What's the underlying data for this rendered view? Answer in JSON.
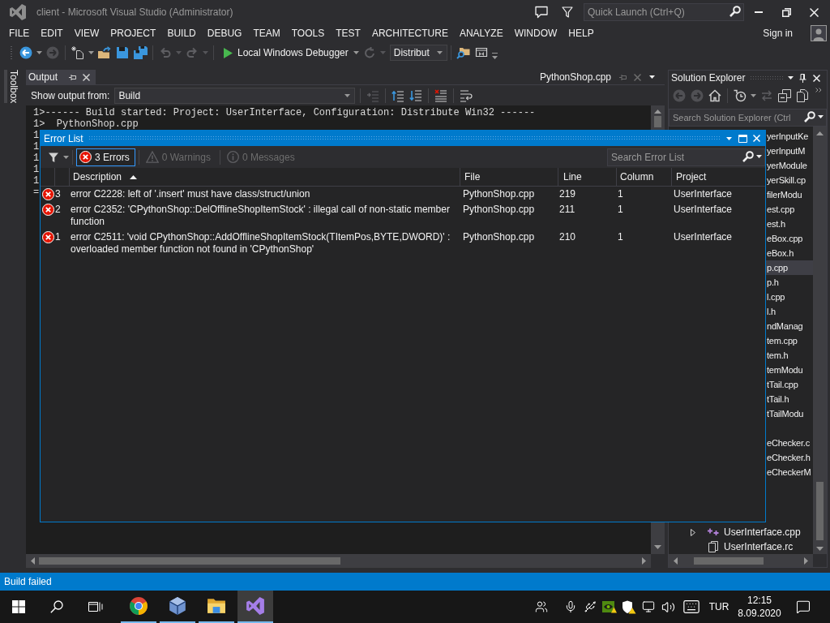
{
  "window": {
    "title": "client - Microsoft Visual Studio (Administrator)",
    "quick_launch": {
      "placeholder": "Quick Launch (Ctrl+Q)"
    },
    "sign_in": "Sign in"
  },
  "menu": [
    "FILE",
    "EDIT",
    "VIEW",
    "PROJECT",
    "BUILD",
    "DEBUG",
    "TEAM",
    "TOOLS",
    "TEST",
    "ARCHITECTURE",
    "ANALYZE",
    "WINDOW",
    "HELP"
  ],
  "toolbar": {
    "groups": [
      [
        {
          "kind": "back",
          "disabled": false
        },
        {
          "kind": "caret",
          "disabled": false
        },
        {
          "kind": "forward",
          "disabled": true
        }
      ],
      [
        {
          "kind": "new-item",
          "disabled": false
        },
        {
          "kind": "caret",
          "disabled": false
        },
        {
          "kind": "open",
          "disabled": false
        },
        {
          "kind": "save",
          "disabled": false
        },
        {
          "kind": "save-all",
          "disabled": false
        }
      ],
      [
        {
          "kind": "undo",
          "disabled": true
        },
        {
          "kind": "caret",
          "disabled": true
        },
        {
          "kind": "redo",
          "disabled": true
        },
        {
          "kind": "caret",
          "disabled": true
        }
      ],
      [
        {
          "kind": "start",
          "label": "Local Windows Debugger",
          "disabled": false
        },
        {
          "kind": "caret",
          "disabled": false
        },
        {
          "kind": "restart",
          "disabled": true
        },
        {
          "kind": "caret",
          "disabled": true
        },
        {
          "kind": "combo",
          "value": "Distribut",
          "disabled": false
        }
      ],
      [
        {
          "kind": "find",
          "disabled": false
        },
        {
          "kind": "device",
          "disabled": false
        },
        {
          "kind": "overflow",
          "disabled": false
        }
      ]
    ]
  },
  "toolbox": {
    "label": "Toolbox"
  },
  "output": {
    "tab": {
      "label": "Output"
    },
    "document_tab": {
      "label": "PythonShop.cpp"
    },
    "source": {
      "label": "Show output from:",
      "value": "Build"
    },
    "toolbar": {
      "groups": [
        [
          {
            "kind": "go-to-code",
            "disabled": true
          }
        ],
        [
          {
            "kind": "previous",
            "disabled": false
          },
          {
            "kind": "next",
            "disabled": false
          }
        ],
        [
          {
            "kind": "clear",
            "disabled": false
          }
        ],
        [
          {
            "kind": "word-wrap",
            "disabled": false
          }
        ]
      ]
    },
    "lines": [
      "1>------ Build started: Project: UserInterface, Configuration: Distribute Win32 ------",
      "1>  PythonShop.cpp",
      "1",
      "1",
      "1",
      "1",
      "1",
      "="
    ]
  },
  "error_list": {
    "title": "Error List",
    "filters": [
      {
        "kind": "error",
        "label": "3 Errors",
        "selected": true
      },
      {
        "kind": "warning",
        "label": "0 Warnings",
        "selected": false
      },
      {
        "kind": "message",
        "label": "0 Messages",
        "selected": false
      }
    ],
    "search": {
      "placeholder": "Search Error List"
    },
    "columns": [
      {
        "label": "Description",
        "sorted": true
      },
      {
        "label": "File",
        "sorted": false
      },
      {
        "label": "Line",
        "sorted": false
      },
      {
        "label": "Column",
        "sorted": false
      },
      {
        "label": "Project",
        "sorted": false
      }
    ],
    "rows": [
      {
        "kind": "error",
        "order": "3",
        "cells": [
          "error C2228: left of '.insert' must have class/struct/union",
          "PythonShop.cpp",
          "219",
          "1",
          "UserInterface"
        ]
      },
      {
        "kind": "error",
        "order": "2",
        "cells": [
          "error C2352: 'CPythonShop::DelOfflineShopItemStock' : illegal call of non-static member function",
          "PythonShop.cpp",
          "211",
          "1",
          "UserInterface"
        ]
      },
      {
        "kind": "error",
        "order": "1",
        "cells": [
          "error C2511: 'void CPythonShop::AddOfflineShopItemStock(TItemPos,BYTE,DWORD)' : overloaded member function not found in 'CPythonShop'",
          "PythonShop.cpp",
          "210",
          "1",
          "UserInterface"
        ]
      }
    ]
  },
  "solution_explorer": {
    "title": "Solution Explorer",
    "toolbar": {
      "groups": [
        [
          {
            "kind": "back",
            "disabled": true
          },
          {
            "kind": "forward",
            "disabled": true
          },
          {
            "kind": "home",
            "disabled": false
          }
        ],
        [
          {
            "kind": "history",
            "disabled": false
          },
          {
            "kind": "caret",
            "disabled": false
          },
          {
            "kind": "sync",
            "disabled": true
          },
          {
            "kind": "collapse",
            "disabled": false
          },
          {
            "kind": "show-all",
            "disabled": false
          },
          {
            "kind": "more",
            "disabled": false
          }
        ]
      ]
    },
    "search": {
      "placeholder": "Search Solution Explorer (Ctrl"
    },
    "clipped_groups": [
      {
        "rows": [
          {
            "label": "yerInputKe",
            "selected": false
          },
          {
            "label": "yerInputM",
            "selected": false
          },
          {
            "label": "yerModule",
            "selected": false
          },
          {
            "label": "yerSkill.cp",
            "selected": false
          },
          {
            "label": "filerModu",
            "selected": false
          },
          {
            "label": "est.cpp",
            "selected": false
          },
          {
            "label": "est.h",
            "selected": false
          },
          {
            "label": "eBox.cpp",
            "selected": false
          },
          {
            "label": "eBox.h",
            "selected": false
          },
          {
            "label": "p.cpp",
            "selected": true
          },
          {
            "label": "p.h",
            "selected": false
          },
          {
            "label": "l.cpp",
            "selected": false
          },
          {
            "label": "l.h",
            "selected": false
          },
          {
            "label": "ndManag",
            "selected": false
          },
          {
            "label": "tem.cpp",
            "selected": false
          },
          {
            "label": "tem.h",
            "selected": false
          },
          {
            "label": "temModu",
            "selected": false
          },
          {
            "label": "tTail.cpp",
            "selected": false
          },
          {
            "label": "tTail.h",
            "selected": false
          },
          {
            "label": "tTailModu",
            "selected": false
          }
        ]
      },
      {
        "rows": [
          {
            "label": "eChecker.c",
            "selected": false
          },
          {
            "label": "eChecker.h",
            "selected": false
          },
          {
            "label": "eCheckerM",
            "selected": false
          }
        ]
      }
    ],
    "items": [
      {
        "kind": "source",
        "label": "UserInterface.cpp",
        "expandable": true,
        "expanded": false
      },
      {
        "kind": "resource",
        "label": "UserInterface.rc",
        "expandable": false
      }
    ]
  },
  "status_bar": {
    "text": "Build failed"
  },
  "taskbar": {
    "apps": [
      {
        "kind": "browser",
        "running": true,
        "active": false
      },
      {
        "kind": "virtual-machine",
        "running": true,
        "active": false
      },
      {
        "kind": "file-explorer",
        "running": true,
        "active": false
      },
      {
        "kind": "visual-studio",
        "running": true,
        "active": true
      }
    ],
    "language": "TUR",
    "time": "12:15",
    "date": "8.09.2020"
  }
}
